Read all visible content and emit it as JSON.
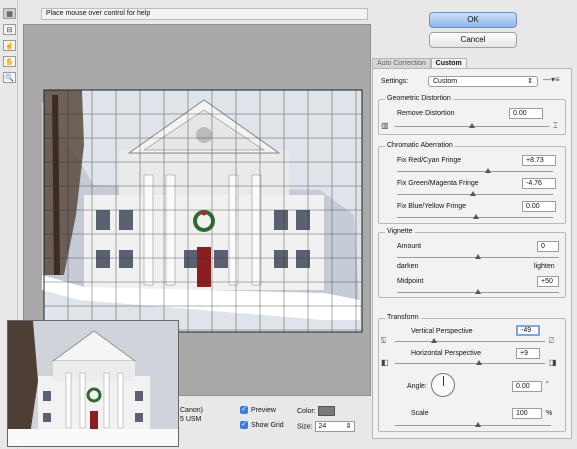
{
  "help": {
    "text": "Place mouse over control for help"
  },
  "tools": [
    {
      "name": "remove-distortion-tool-icon",
      "glyph": "▦"
    },
    {
      "name": "straighten-tool-icon",
      "glyph": "⊟"
    },
    {
      "name": "move-grid-tool-icon",
      "glyph": "☝"
    },
    {
      "name": "hand-tool-icon",
      "glyph": "✋"
    },
    {
      "name": "zoom-tool-icon",
      "glyph": "🔍"
    }
  ],
  "buttons": {
    "ok": "OK",
    "cancel": "Cancel"
  },
  "tabs": {
    "auto": "Auto Correction",
    "custom": "Custom"
  },
  "settings": {
    "label": "Settings:",
    "value": "Custom"
  },
  "geometric": {
    "title": "Geometric Distortion",
    "remove_label": "Remove Distortion",
    "remove_value": "0.00"
  },
  "chromatic": {
    "title": "Chromatic Aberration",
    "red_label": "Fix Red/Cyan Fringe",
    "red_value": "+8.73",
    "green_label": "Fix Green/Magenta Fringe",
    "green_value": "-4.76",
    "blue_label": "Fix Blue/Yellow Fringe",
    "blue_value": "0.00"
  },
  "vignette": {
    "title": "Vignette",
    "amount_label": "Amount",
    "amount_value": "0",
    "darken": "darken",
    "lighten": "lighten",
    "midpoint_label": "Midpoint",
    "midpoint_value": "+50"
  },
  "transform": {
    "title": "Transform",
    "vertical_label": "Vertical Perspective",
    "vertical_value": "-49",
    "horizontal_label": "Horizontal Perspective",
    "horizontal_value": "+9",
    "angle_label": "Angle:",
    "angle_value": "0.00",
    "angle_unit": "°",
    "scale_label": "Scale",
    "scale_value": "100",
    "scale_unit": "%"
  },
  "bottom": {
    "preview_label": "Preview",
    "showgrid_label": "Show Grid",
    "color_label": "Color:",
    "size_label": "Size:",
    "size_value": "24",
    "partial_line1": "Canon)",
    "partial_line2": "5 USM"
  },
  "colors": {
    "grid_color": "#7a7a7a",
    "ok_accent": "#8fb5ec",
    "checkbox_accent": "#3d7be4"
  }
}
